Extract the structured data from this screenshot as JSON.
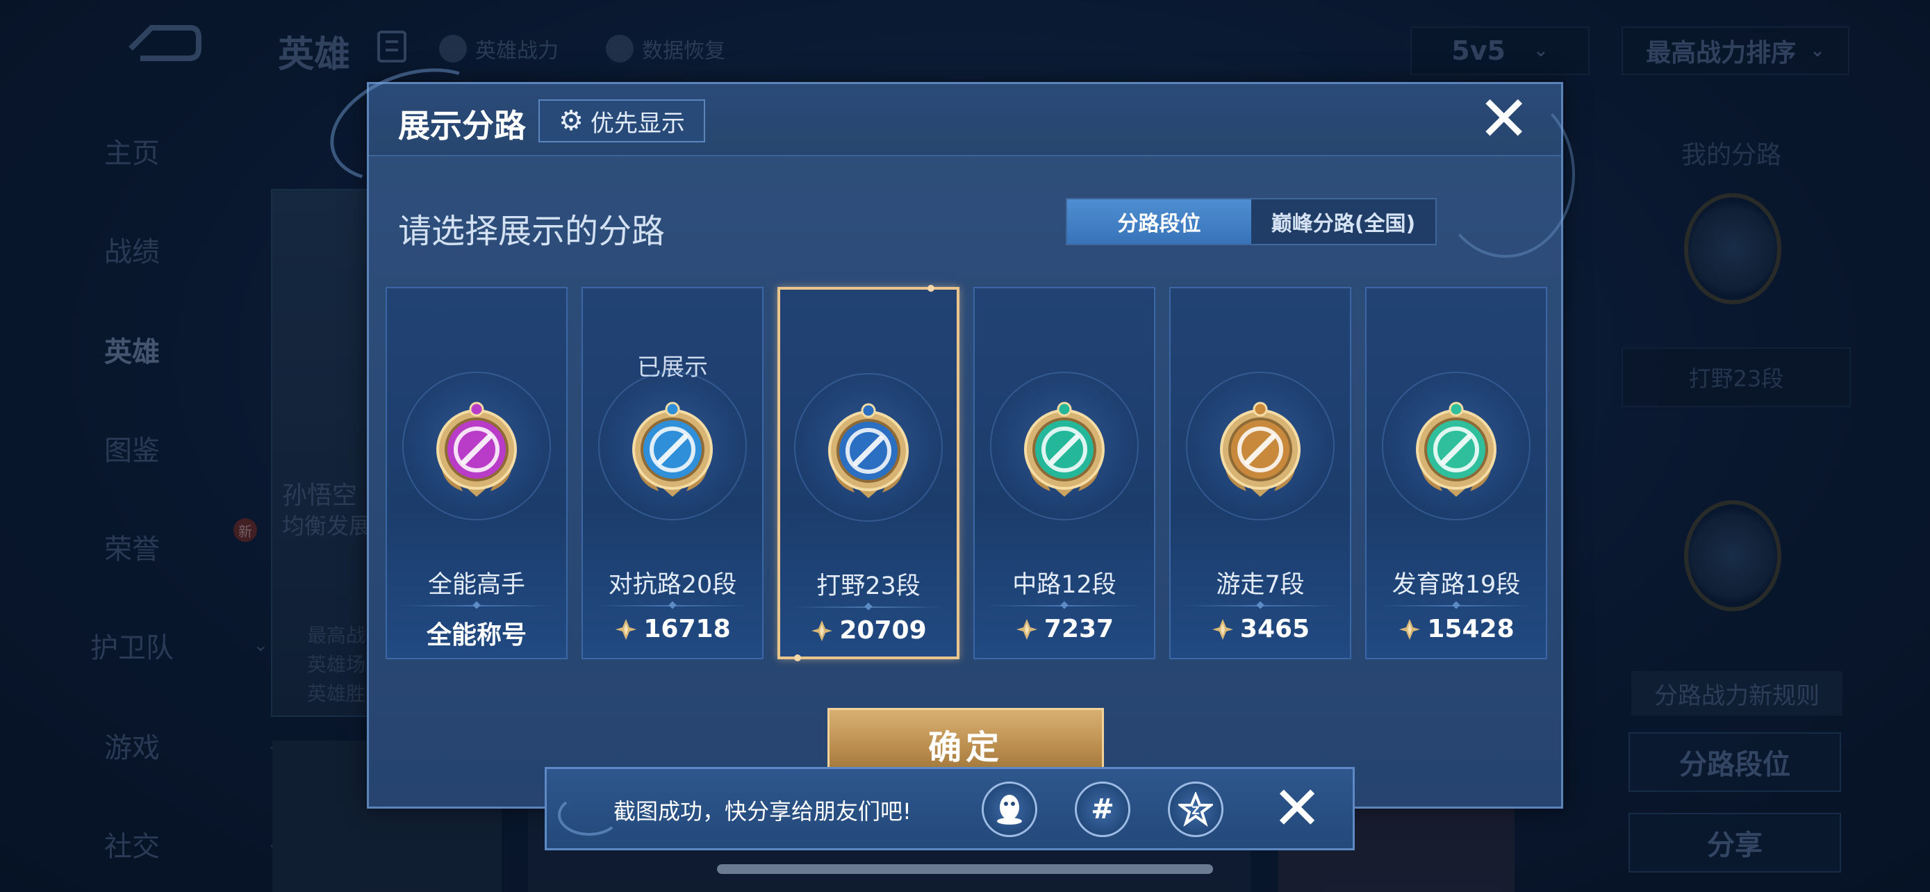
{
  "background": {
    "top_bar": {
      "title": "英雄",
      "hero_power_label": "英雄战力",
      "data_restore_label": "数据恢复",
      "mode_select": "5v5",
      "sort_select": "最高战力排序"
    },
    "side_nav": [
      {
        "label": "主页"
      },
      {
        "label": "战绩"
      },
      {
        "label": "英雄"
      },
      {
        "label": "图鉴"
      },
      {
        "label": "荣誉",
        "badge": "新"
      },
      {
        "label": "护卫队"
      },
      {
        "label": "游戏"
      },
      {
        "label": "社交"
      }
    ],
    "hero_card": {
      "name": "孙悟空",
      "subtitle": "均衡发展",
      "stats": [
        "最高战",
        "英雄场",
        "英雄胜"
      ]
    },
    "right_panel": {
      "title": "我的分路",
      "current_rank": "打野23段",
      "rules_label": "分路战力新规则",
      "rank_button": "分路段位",
      "share_button": "分享"
    }
  },
  "modal": {
    "title": "展示分路",
    "priority_button": "优先显示",
    "prompt": "请选择展示的分路",
    "toggle": [
      "分路段位",
      "巅峰分路(全国)"
    ],
    "toggle_selected_index": 0,
    "confirm_button": "确定",
    "cards": [
      {
        "label": "全能高手",
        "value": "全能称号",
        "status": "",
        "emblem": "all-round-emblem",
        "color": "#b93cc8",
        "selected": false,
        "show_power_icon": false
      },
      {
        "label": "对抗路20段",
        "value": "16718",
        "status": "已展示",
        "emblem": "clash-lane-emblem",
        "color": "#2f8fd8",
        "selected": false,
        "show_power_icon": true
      },
      {
        "label": "打野23段",
        "value": "20709",
        "status": "",
        "emblem": "jungle-emblem",
        "color": "#2a6fc2",
        "selected": true,
        "show_power_icon": true
      },
      {
        "label": "中路12段",
        "value": "7237",
        "status": "",
        "emblem": "mid-lane-emblem",
        "color": "#25b79a",
        "selected": false,
        "show_power_icon": true
      },
      {
        "label": "游走7段",
        "value": "3465",
        "status": "",
        "emblem": "roam-emblem",
        "color": "#c8893c",
        "selected": false,
        "show_power_icon": true
      },
      {
        "label": "发育路19段",
        "value": "15428",
        "status": "",
        "emblem": "farm-lane-emblem",
        "color": "#2fbf9c",
        "selected": false,
        "show_power_icon": true
      }
    ]
  },
  "toast": {
    "message": "截图成功，快分享给朋友们吧!",
    "share_targets": [
      "qq-icon",
      "moments-icon",
      "qzone-icon"
    ]
  }
}
